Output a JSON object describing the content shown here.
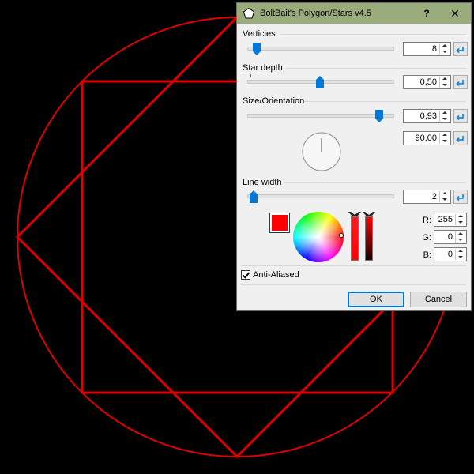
{
  "dialog": {
    "title": "BoltBait's Polygon/Stars v4.5",
    "help_label": "?",
    "close_label": "✕"
  },
  "verticies": {
    "label": "Verticies",
    "value": "8",
    "level": 0.04
  },
  "star_depth": {
    "label": "Star depth",
    "value": "0,50",
    "level": 0.5
  },
  "size_orientation": {
    "label": "Size/Orientation",
    "size_value": "0,93",
    "size_level": 0.93,
    "angle_value": "90,00"
  },
  "line_width": {
    "label": "Line width",
    "value": "2",
    "level": 0.02
  },
  "color": {
    "hex": "#ff0000",
    "r_label": "R:",
    "r_value": "255",
    "g_label": "G:",
    "g_value": "0",
    "b_label": "B:",
    "b_value": "0"
  },
  "anti_aliased": {
    "label": "Anti-Aliased",
    "checked": true
  },
  "buttons": {
    "ok": "OK",
    "cancel": "Cancel"
  },
  "colors": {
    "accent": "#0078d7",
    "titlebar": "#9aac7c",
    "stroke": "#ff0000",
    "background": "#000000"
  }
}
